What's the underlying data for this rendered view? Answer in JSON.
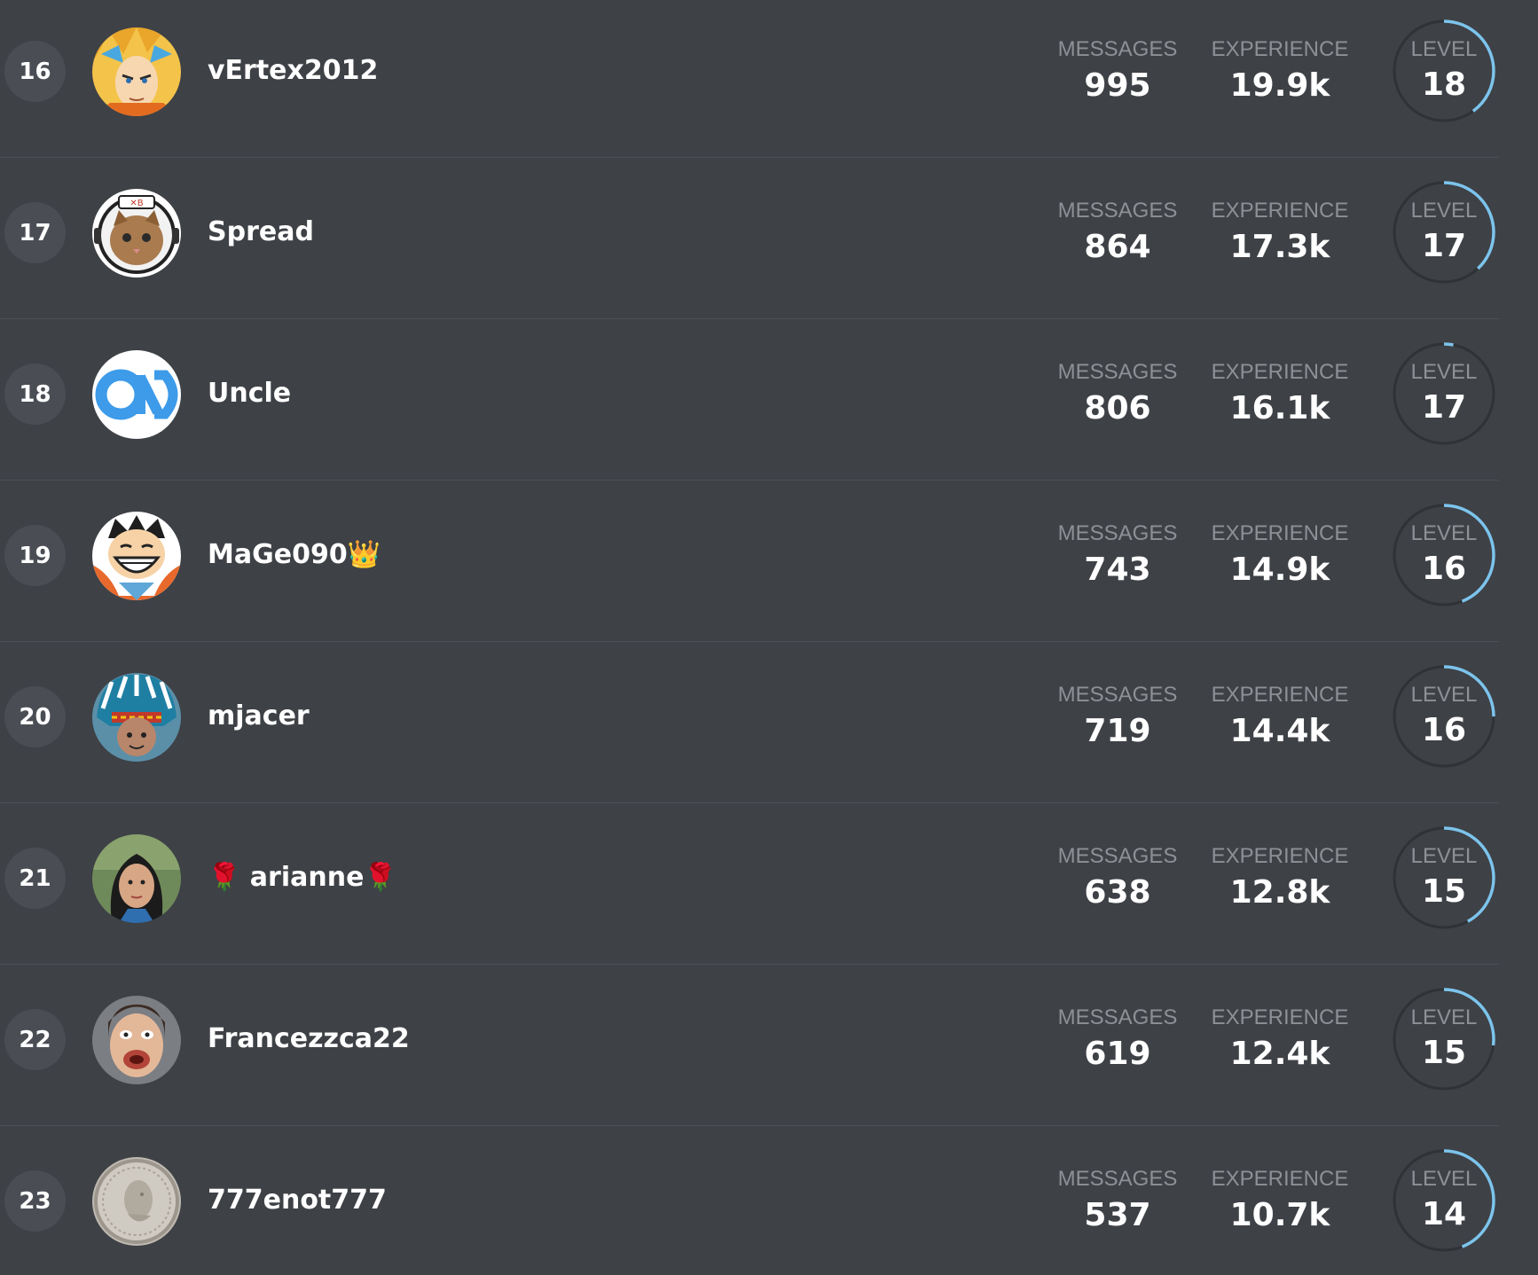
{
  "leaderboard": {
    "labels": {
      "messages": "MESSAGES",
      "experience": "EXPERIENCE",
      "level": "LEVEL"
    },
    "colors": {
      "background": "#3e4146",
      "rank_badge": "#4a4e54",
      "ring_track": "#2f3236",
      "ring_progress": "#7cc4ec",
      "label": "#8d9196",
      "divider": "#4c5056"
    },
    "rows": [
      {
        "rank": "16",
        "username": "vErtex2012",
        "avatar": "anime-fighter-avatar",
        "messages": "995",
        "experience": "19.9k",
        "level": "18",
        "level_progress": 0.4
      },
      {
        "rank": "17",
        "username": "Spread",
        "avatar": "astronaut-cat-avatar",
        "messages": "864",
        "experience": "17.3k",
        "level": "17",
        "level_progress": 0.38
      },
      {
        "rank": "18",
        "username": "Uncle",
        "avatar": "dnd-logo-avatar",
        "messages": "806",
        "experience": "16.1k",
        "level": "17",
        "level_progress": 0.03
      },
      {
        "rank": "19",
        "username": "MaGe090👑",
        "avatar": "grinning-pirate-avatar",
        "messages": "743",
        "experience": "14.9k",
        "level": "16",
        "level_progress": 0.44
      },
      {
        "rank": "20",
        "username": "mjacer",
        "avatar": "headdress-portrait-avatar",
        "messages": "719",
        "experience": "14.4k",
        "level": "16",
        "level_progress": 0.25
      },
      {
        "rank": "21",
        "username": "🌹 arianne🌹",
        "avatar": "woman-portrait-avatar",
        "messages": "638",
        "experience": "12.8k",
        "level": "15",
        "level_progress": 0.42
      },
      {
        "rank": "22",
        "username": "Francezzca22",
        "avatar": "funny-face-avatar",
        "messages": "619",
        "experience": "12.4k",
        "level": "15",
        "level_progress": 0.27
      },
      {
        "rank": "23",
        "username": "777enot777",
        "avatar": "silver-coin-avatar",
        "messages": "537",
        "experience": "10.7k",
        "level": "14",
        "level_progress": 0.44
      }
    ]
  }
}
